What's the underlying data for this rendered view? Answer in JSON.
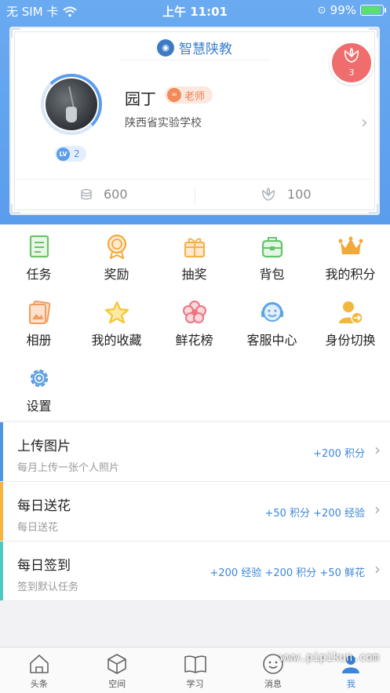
{
  "status_bar": {
    "carrier": "无 SIM 卡",
    "time": "上午 11:01",
    "battery": "99%"
  },
  "profile": {
    "brand": "智慧陕教",
    "flower_count": "3",
    "name": "园丁",
    "role": "老师",
    "school": "陕西省实验学校",
    "level": "2",
    "coins": "600",
    "flowers": "100"
  },
  "grid": {
    "items": [
      {
        "label": "任务",
        "icon": "task-icon",
        "color": "#6cc36a"
      },
      {
        "label": "奖励",
        "icon": "medal-icon",
        "color": "#f2a93b"
      },
      {
        "label": "抽奖",
        "icon": "gift-icon",
        "color": "#f5b44a"
      },
      {
        "label": "背包",
        "icon": "backpack-icon",
        "color": "#63c36a"
      },
      {
        "label": "我的积分",
        "icon": "crown-icon",
        "color": "#f2a93b"
      },
      {
        "label": "相册",
        "icon": "album-icon",
        "color": "#f19c59"
      },
      {
        "label": "我的收藏",
        "icon": "star-icon",
        "color": "#f6c534"
      },
      {
        "label": "鲜花榜",
        "icon": "flower-icon",
        "color": "#ef7380"
      },
      {
        "label": "客服中心",
        "icon": "headset-icon",
        "color": "#5aa4e8"
      },
      {
        "label": "身份切换",
        "icon": "switch-user-icon",
        "color": "#f2b83b"
      },
      {
        "label": "设置",
        "icon": "gear-icon",
        "color": "#4f96e0"
      }
    ]
  },
  "tasks": [
    {
      "title": "上传图片",
      "desc": "每月上传一张个人照片",
      "reward": "+200 积分",
      "bar_color": "#4d94e6"
    },
    {
      "title": "每日送花",
      "desc": "每日送花",
      "reward": "+50 积分  +200 经验",
      "bar_color": "#f5b53d"
    },
    {
      "title": "每日签到",
      "desc": "签到默认任务",
      "reward": "+200 经验  +200 积分  +50 鲜花",
      "bar_color": "#4cc9c0"
    }
  ],
  "tabbar": {
    "tabs": [
      {
        "label": "头条",
        "icon": "home-icon"
      },
      {
        "label": "空间",
        "icon": "cube-icon"
      },
      {
        "label": "学习",
        "icon": "book-icon"
      },
      {
        "label": "消息",
        "icon": "message-icon"
      },
      {
        "label": "我",
        "icon": "user-icon"
      }
    ],
    "active": "我"
  },
  "watermark": "www.pipikun.com"
}
